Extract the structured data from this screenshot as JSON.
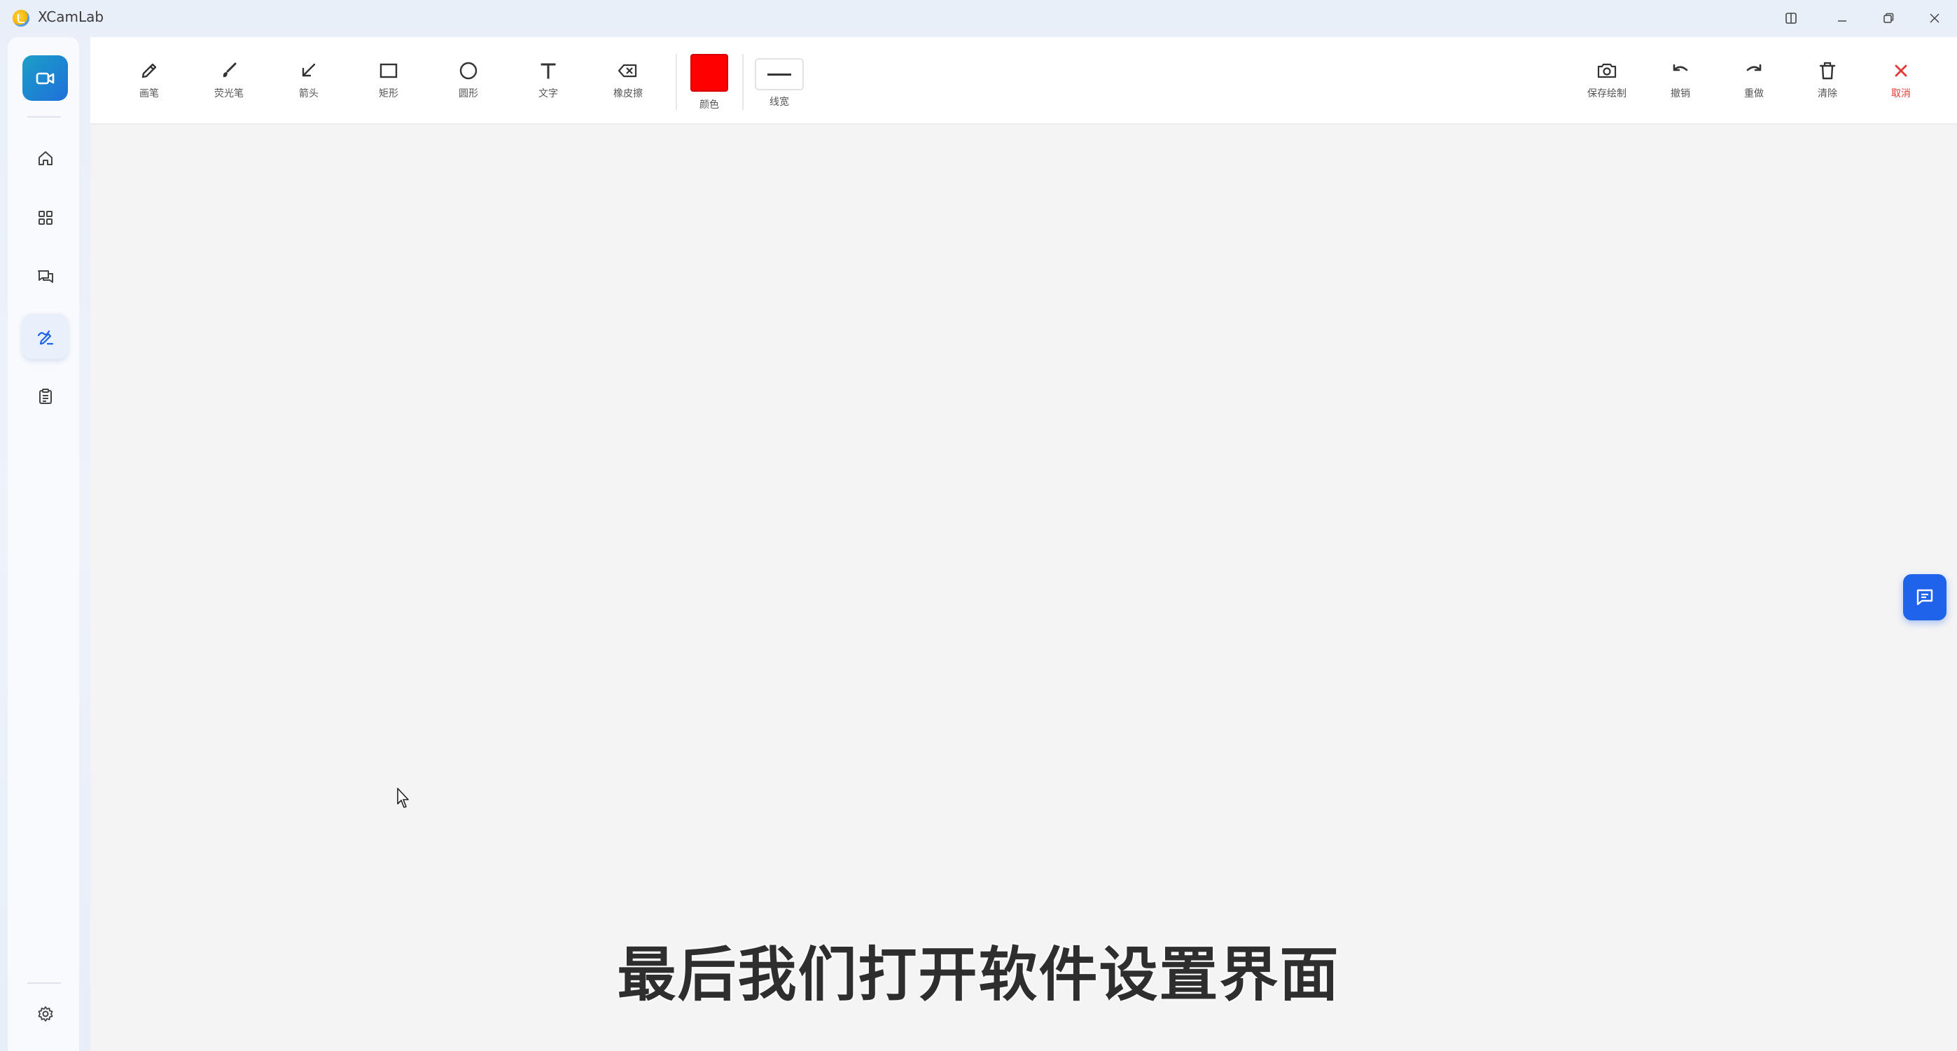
{
  "window": {
    "title": "XCamLab"
  },
  "toolbar": {
    "tools": [
      {
        "label": "画笔",
        "icon": "pencil-icon"
      },
      {
        "label": "荧光笔",
        "icon": "brush-icon"
      },
      {
        "label": "箭头",
        "icon": "arrow-icon"
      },
      {
        "label": "矩形",
        "icon": "rectangle-icon"
      },
      {
        "label": "圆形",
        "icon": "circle-icon"
      },
      {
        "label": "文字",
        "icon": "text-icon"
      },
      {
        "label": "橡皮擦",
        "icon": "eraser-icon"
      }
    ],
    "color_label": "颜色",
    "color_value": "#ff0000",
    "linewidth_label": "线宽",
    "actions": [
      {
        "label": "保存绘制",
        "icon": "camera-icon"
      },
      {
        "label": "撤销",
        "icon": "undo-icon"
      },
      {
        "label": "重做",
        "icon": "redo-icon"
      },
      {
        "label": "清除",
        "icon": "trash-icon"
      },
      {
        "label": "取消",
        "icon": "close-icon"
      }
    ]
  },
  "sidebar": {
    "items": [
      {
        "icon": "home-icon",
        "active": false
      },
      {
        "icon": "grid-icon",
        "active": false
      },
      {
        "icon": "chat-icon",
        "active": false
      },
      {
        "icon": "draw-icon",
        "active": true
      },
      {
        "icon": "clipboard-icon",
        "active": false
      }
    ],
    "bottom_icon": "settings-icon"
  },
  "colors": {
    "accent": "#1e63e9",
    "cancel": "#e53935"
  },
  "subtitle": "最后我们打开软件设置界面"
}
